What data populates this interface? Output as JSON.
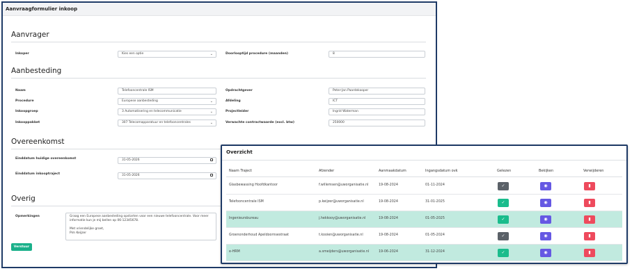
{
  "form": {
    "title": "Aanvraagformulier inkoop",
    "sections": {
      "aanvrager": "Aanvrager",
      "aanbesteding": "Aanbesteding",
      "overeenkomst": "Overeenkomst",
      "overig": "Overig"
    },
    "aanvrager": {
      "inkoper_label": "Inkoper",
      "inkoper_value": "Kies een optie",
      "doorloop_label": "Doorlooptijd procedure (maanden)",
      "doorloop_value": "8"
    },
    "aanbesteding": {
      "naam_label": "Naam",
      "naam_value": "Telefooncentrale ISM",
      "procedure_label": "Procedure",
      "procedure_value": "Europese aanbesteding",
      "inkoopgroep_label": "Inkoopgroep",
      "inkoopgroep_value": "3 Automatisering en telecommunicatie",
      "inkooppakket_label": "Inkooppakket",
      "inkooppakket_value": "307 Telecomapparatuur en telefooncentrales",
      "opdrachtgever_label": "Opdrachtgever",
      "opdrachtgever_value": "Peter-Jan Paardekooper",
      "afdeling_label": "Afdeling",
      "afdeling_value": "ICT",
      "projectleider_label": "Projectleider",
      "projectleider_value": "Ingrid Waterman",
      "contractwaarde_label": "Verwachte contractwaarde (excl. btw)",
      "contractwaarde_value": "250000"
    },
    "overeenkomst": {
      "einddatum_huidig_label": "Einddatum huidige overeenkomst",
      "einddatum_huidig_value": "31-05-2026",
      "einddatum_inkoop_label": "Einddatum inkooptraject",
      "einddatum_inkoop_value": "31-05-2026"
    },
    "overig": {
      "opmerkingen_label": "Opmerkingen",
      "opmerkingen_value": "Graag een Europese aanbesteding opstarten voor een nieuwe telefooncentrale. Voor meer informatie kun je mij bellen op 06-12345678.\n\nMet vriendelijke groet,\nPim Keijzer"
    },
    "submit_label": "Verstuur"
  },
  "overview": {
    "title": "Overzicht",
    "headers": [
      "Naam Traject",
      "Afzender",
      "Aanmaakdatum",
      "Ingangsdatum ovk",
      "Gelezen",
      "Bekijken",
      "Verwijderen"
    ],
    "rows": [
      {
        "name": "Glasbewassing Hoofdkantoor",
        "sender": "f.willemsen@uworganisatie.nl",
        "created": "19-08-2024",
        "start": "01-11-2024",
        "read": false,
        "highlight": false
      },
      {
        "name": "Telefooncentrale ISM",
        "sender": "p.keijzer@uworganisatie.nl",
        "created": "19-08-2024",
        "start": "31-01-2025",
        "read": true,
        "highlight": false
      },
      {
        "name": "Ingenieursbureau",
        "sender": "j.hekkooy@uworganisatie.nl",
        "created": "19-08-2024",
        "start": "01-05-2025",
        "read": true,
        "highlight": true
      },
      {
        "name": "Groenonderhoud Apeldoornsestraat",
        "sender": "t.kooien@uworganisatie.nl",
        "created": "19-08-2024",
        "start": "01-05-2024",
        "read": false,
        "highlight": false
      },
      {
        "name": "e-HRM",
        "sender": "a.smeijders@uworganisatie.nl",
        "created": "19-06-2024",
        "start": "31-12-2024",
        "read": true,
        "highlight": true
      }
    ],
    "icons": {
      "read": "check-icon",
      "unread": "check-icon",
      "view": "eye-icon",
      "delete": "trash-icon"
    },
    "colors": {
      "unread": "#5b6168",
      "read": "#1abc8c",
      "view": "#6558e3",
      "delete": "#ee4a5d",
      "highlight": "#c1eadf"
    }
  }
}
